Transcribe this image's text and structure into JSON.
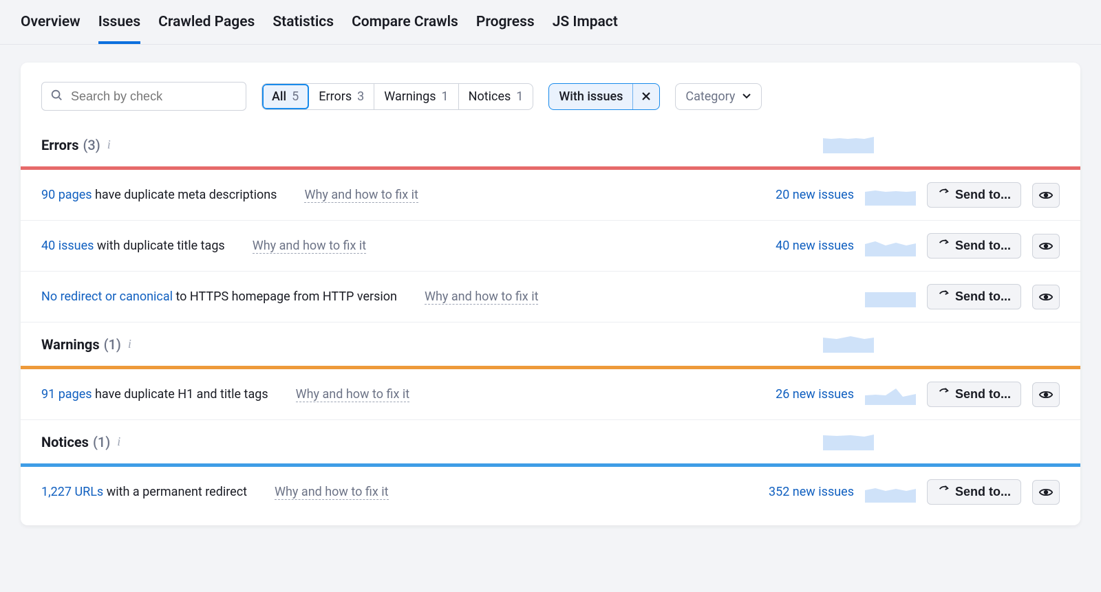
{
  "tabs": [
    "Overview",
    "Issues",
    "Crawled Pages",
    "Statistics",
    "Compare Crawls",
    "Progress",
    "JS Impact"
  ],
  "active_tab": 1,
  "search": {
    "placeholder": "Search by check"
  },
  "seg": {
    "all": {
      "label": "All",
      "count": "5"
    },
    "errors": {
      "label": "Errors",
      "count": "3"
    },
    "warnings": {
      "label": "Warnings",
      "count": "1"
    },
    "notices": {
      "label": "Notices",
      "count": "1"
    }
  },
  "chip": {
    "label": "With issues"
  },
  "category": {
    "label": "Category"
  },
  "fix_label": "Why and how to fix it",
  "send_label": "Send to...",
  "sections": {
    "errors": {
      "title": "Errors",
      "count": "(3)"
    },
    "warnings": {
      "title": "Warnings",
      "count": "(1)"
    },
    "notices": {
      "title": "Notices",
      "count": "(1)"
    }
  },
  "issues": {
    "err1": {
      "link": "90 pages",
      "text": " have duplicate meta descriptions",
      "new": "20 new issues"
    },
    "err2": {
      "link": "40 issues",
      "text": " with duplicate title tags",
      "new": "40 new issues"
    },
    "err3": {
      "link": "No redirect or canonical",
      "text": " to HTTPS homepage from HTTP version",
      "new": ""
    },
    "warn1": {
      "link": "91 pages",
      "text": " have duplicate H1 and title tags",
      "new": "26 new issues"
    },
    "not1": {
      "link": "1,227 URLs",
      "text": " with a permanent redirect",
      "new": "352 new issues"
    }
  }
}
